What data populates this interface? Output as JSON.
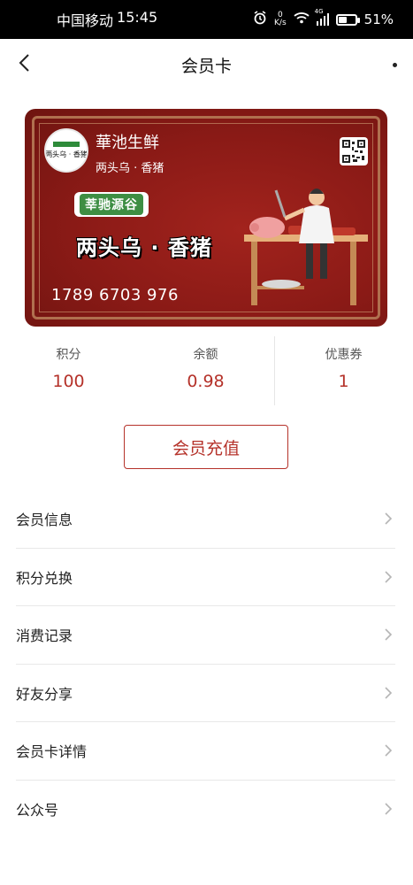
{
  "status_bar": {
    "carrier": "中国移动",
    "time": "15:45",
    "net_speed_value": "0",
    "net_speed_unit": "K/s",
    "network_type": "4G",
    "battery_percent": "51%",
    "battery_level": 0.51
  },
  "nav": {
    "title": "会员卡"
  },
  "card": {
    "logo_text": "两头乌 · 香猪",
    "shop_name": "華池生鲜",
    "shop_subtitle": "两头乌 · 香猪",
    "brand_badge": "莘驰源谷",
    "product_title": "两头乌 · 香猪",
    "card_number": "1789 6703 976",
    "colors": {
      "background": "#8a1a16",
      "frame": "#b0704f",
      "badge_green": "#3e8e43"
    }
  },
  "stats": [
    {
      "label": "积分",
      "value": "100"
    },
    {
      "label": "余额",
      "value": "0.98"
    },
    {
      "label": "优惠券",
      "value": "1"
    }
  ],
  "recharge_button": "会员充值",
  "menu": [
    {
      "label": "会员信息"
    },
    {
      "label": "积分兑换"
    },
    {
      "label": "消费记录"
    },
    {
      "label": "好友分享"
    },
    {
      "label": "会员卡详情"
    },
    {
      "label": "公众号"
    }
  ],
  "accent_color": "#b5322a",
  "icons": [
    "alarm-icon",
    "wifi-icon",
    "signal-icon",
    "battery-icon",
    "back-arrow-icon",
    "more-icon",
    "qr-code-icon",
    "chevron-right-icon"
  ]
}
